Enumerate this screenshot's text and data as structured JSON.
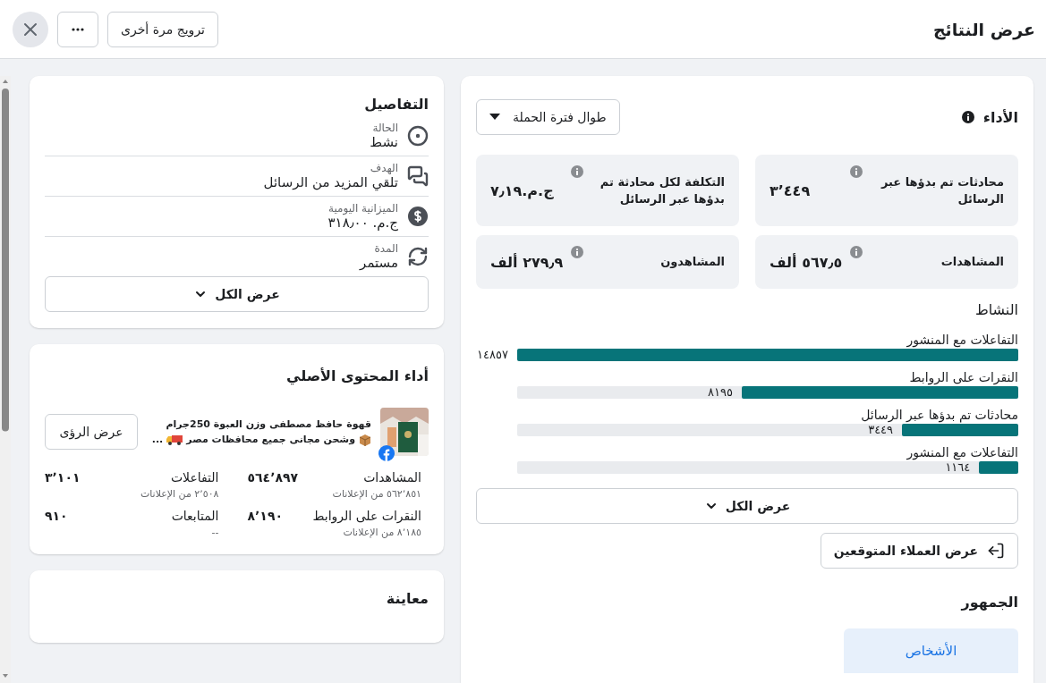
{
  "header": {
    "title": "عرض النتائج",
    "promote_button": "ترويج مرة أخرى"
  },
  "performance": {
    "title": "الأداء",
    "period_dropdown": "طوال فترة الحملة",
    "metrics": [
      {
        "label": "محادثات تم بدؤها عبر الرسائل",
        "value": "٣٬٤٤٩"
      },
      {
        "label": "التكلفة لكل محادثة تم بدؤها عبر الرسائل",
        "value": "ج.م.٧٫١٩"
      },
      {
        "label": "المشاهدات",
        "value": "٥٦٧٫٥ ألف"
      },
      {
        "label": "المشاهدون",
        "value": "٢٧٩٫٩ ألف"
      }
    ],
    "activity": {
      "title": "النشاط",
      "items": [
        {
          "label": "التفاعلات مع المنشور",
          "value": "١٤٨٥٧",
          "level": 1
        },
        {
          "label": "النقرات على الروابط",
          "value": "٨١٩٥",
          "level": 0.552
        },
        {
          "label": "محادثات تم بدؤها عبر الرسائل",
          "value": "٣٤٤٩",
          "level": 0.232
        },
        {
          "label": "التفاعلات مع المنشور",
          "value": "١١٦٤",
          "level": 0.078
        }
      ],
      "show_all": "عرض الكل"
    },
    "leads_button": "عرض العملاء المتوقعين",
    "audience": {
      "title": "الجمهور",
      "tabs": [
        {
          "label": "الأشخاص",
          "selected": true
        }
      ]
    }
  },
  "details": {
    "title": "التفاصيل",
    "items": [
      {
        "kind": "status",
        "label": "الحالة",
        "value": "نشط"
      },
      {
        "kind": "goal",
        "label": "الهدف",
        "value": "تلقي المزيد من الرسائل"
      },
      {
        "kind": "budget",
        "label": "الميزانية اليومية",
        "value": "ج.م. ٣١٨٫٠٠"
      },
      {
        "kind": "duration",
        "label": "المدة",
        "value": "مستمر"
      }
    ],
    "show_all": "عرض الكل"
  },
  "content": {
    "title": "أداء المحتوى الأصلي",
    "post": {
      "line1": "قهوة حافظ مصطفى وزن العبوة 250جرام",
      "line2": "وشحن مجانى جميع محافظات مصر",
      "ellipsis": "..."
    },
    "insights_button": "عرض الرؤى",
    "stats": [
      {
        "label": "المشاهدات",
        "value": "٥٦٤٬٨٩٧",
        "sub": "٥٦٢٬٨٥١ من الإعلانات"
      },
      {
        "label": "التفاعلات",
        "value": "٣٬١٠١",
        "sub": "٢٬٥٠٨ من الإعلانات"
      },
      {
        "label": "النقرات على الروابط",
        "value": "٨٬١٩٠",
        "sub": "٨٬١٨٥ من الإعلانات"
      },
      {
        "label": "المتابعات",
        "value": "٩١٠",
        "sub": "--"
      }
    ]
  },
  "preview": {
    "title": "معاينة"
  }
}
